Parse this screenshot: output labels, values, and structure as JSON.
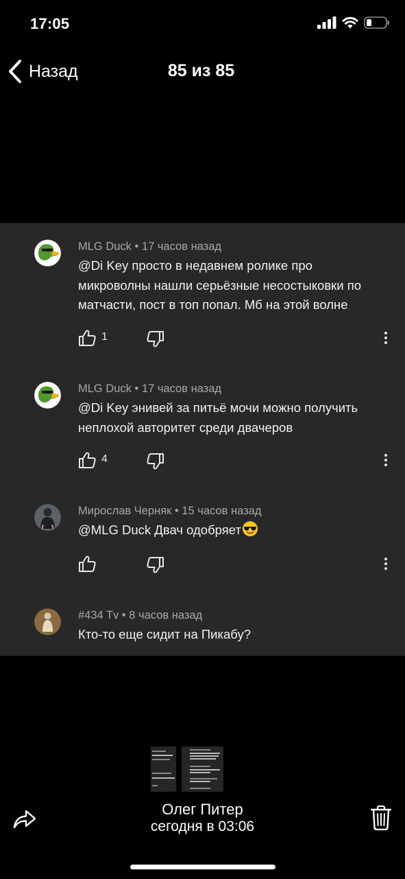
{
  "status_bar": {
    "time": "17:05"
  },
  "nav": {
    "back_label": "Назад",
    "title": "85 из 85"
  },
  "comments": [
    {
      "author": "MLG Duck",
      "time": "17 часов назад",
      "text_lines": [
        "@Di Key просто в недавнем ролике про",
        "микроволны нашли серьёзные несостыковки по",
        "матчасти, пост в топ попал. Мб на этой волне"
      ],
      "likes": "1",
      "avatar_icon": "duck-avatar-icon"
    },
    {
      "author": "MLG Duck",
      "time": "17 часов назад",
      "text_lines": [
        "@Di Key энивей за питьё мочи можно получить",
        "неплохой авторитет среди двачеров"
      ],
      "likes": "4",
      "avatar_icon": "duck-avatar-icon"
    },
    {
      "author": "Мирослав Черняк",
      "time": "15 часов назад",
      "text_lines": [
        "@MLG Duck Двач одобряет"
      ],
      "likes": "",
      "avatar_icon": "person-avatar-icon",
      "emoji": "sunglasses-emoji-icon"
    },
    {
      "author": "#434 Tv",
      "time": "8 часов назад",
      "text_lines": [
        "Кто-то еще сидит на Пикабу?"
      ],
      "avatar_icon": "figure-avatar-icon"
    }
  ],
  "footer": {
    "sender": "Олег Питер",
    "sent_time": "сегодня в 03:06"
  },
  "colors": {
    "background": "#000000",
    "photo_background": "#282828",
    "meta_text": "#a8a8a8",
    "duck_green": "#4f9a2a"
  }
}
